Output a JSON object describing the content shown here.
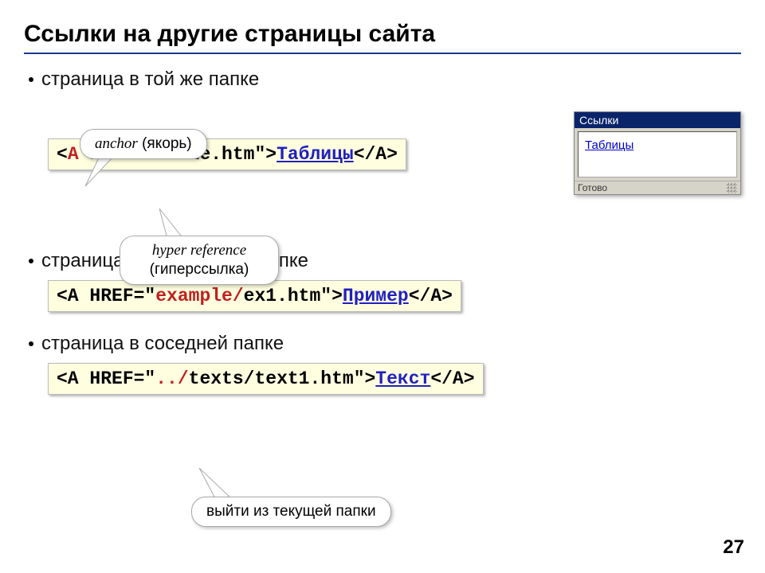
{
  "title": "Ссылки на другие страницы сайта",
  "bullets": [
    "страница в той же папке",
    "страница во вложенной папке",
    "страница в соседней папке"
  ],
  "callouts": {
    "anchor": {
      "line1": "anchor",
      "line2": " (якорь)"
    },
    "href": {
      "line1": "hyper reference",
      "line2": "(гиперссылка)"
    },
    "dotdot": {
      "text": "выйти из текущей папки"
    }
  },
  "code": {
    "ex1": {
      "pre": "<",
      "a": "A",
      "href_attr": " HREF=\"table.htm\">",
      "linktext": "Таблицы",
      "close": "</A>"
    },
    "ex2": {
      "pre": "<A HREF=\"",
      "folder": "example/",
      "rest": "ex1.htm\">",
      "linktext": "Пример",
      "close": "</A>"
    },
    "ex3": {
      "pre": "<A HREF=\"",
      "dotdot": "../",
      "rest": "texts/text1.htm\">",
      "linktext": "Текст",
      "close": "</A>"
    }
  },
  "browser": {
    "title": "Ссылки",
    "link": "Таблицы",
    "status": "Готово"
  },
  "page_number": "27"
}
